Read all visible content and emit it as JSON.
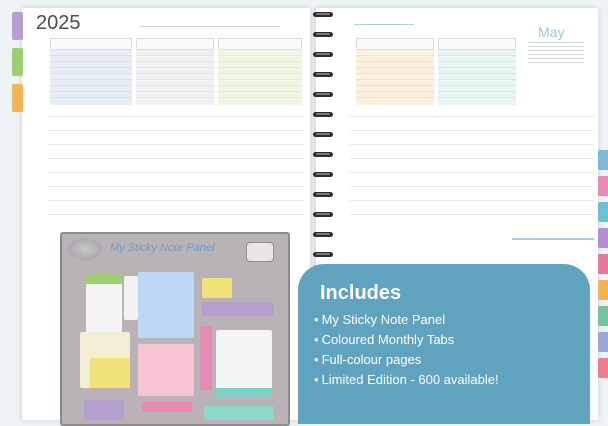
{
  "planner": {
    "year": "2025",
    "month": "May"
  },
  "sticky_panel": {
    "title": "My Sticky Note Panel"
  },
  "includes": {
    "title": "Includes",
    "items": [
      "My Sticky Note Panel",
      "Coloured Monthly Tabs",
      "Full-colour pages",
      "Limited Edition - 600 available!"
    ]
  },
  "colors": {
    "accent_teal": "#5fa3be",
    "tab_purple": "#b49fcf",
    "tab_green": "#9ccf6f",
    "tab_orange": "#f2b455"
  }
}
